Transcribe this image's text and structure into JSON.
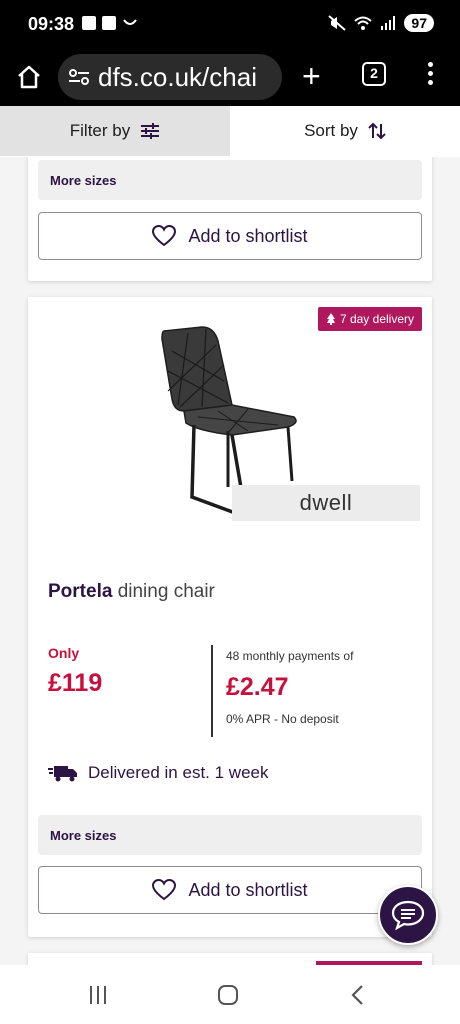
{
  "status_bar": {
    "time": "09:38",
    "battery": "97"
  },
  "browser": {
    "url": "dfs.co.uk/chai",
    "tab_count": "2"
  },
  "toolbar": {
    "filter_label": "Filter by",
    "sort_label": "Sort by"
  },
  "prev_card": {
    "more_sizes": "More sizes",
    "shortlist_label": "Add to shortlist"
  },
  "product": {
    "badge": "7 day delivery",
    "brand": "dwell",
    "name_bold": "Portela",
    "name_rest": " dining chair",
    "only_label": "Only",
    "price": "£119",
    "monthly_label": "48 monthly payments of",
    "monthly_price": "£2.47",
    "apr_label": "0% APR - No deposit",
    "delivery_text": "Delivered in est. 1 week",
    "more_sizes": "More sizes",
    "shortlist_label": "Add to shortlist"
  },
  "colors": {
    "brand_purple": "#2c1444",
    "price_red": "#c8103e",
    "badge_magenta": "#b0185e"
  }
}
